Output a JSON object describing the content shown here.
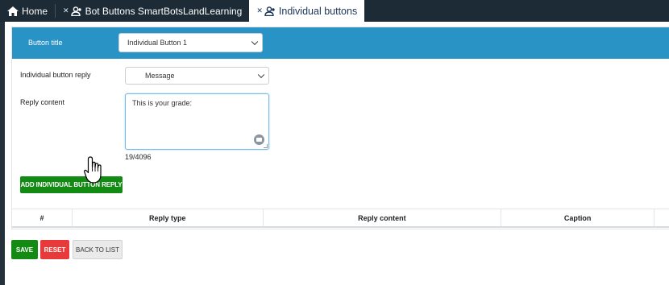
{
  "tabs": [
    {
      "label": "Home",
      "icon": "home-icon"
    },
    {
      "label": "Bot Buttons SmartBotsLandLearning",
      "icon": "user-group-icon"
    },
    {
      "label": "Individual buttons",
      "icon": "user-group-icon"
    }
  ],
  "form": {
    "button_title_label": "Button title",
    "button_title_value": "Individual Button 1",
    "reply_label": "Individual button reply",
    "reply_value": "Message",
    "content_label": "Reply content",
    "content_value": "This is your grade:",
    "counter": "19/4096",
    "add_button_label": "ADD INDIVIDUAL BUTTON REPLY"
  },
  "table": {
    "columns": [
      "#",
      "Reply type",
      "Reply content",
      "Caption"
    ]
  },
  "footer": {
    "save_label": "SAVE",
    "reset_label": "RESET",
    "back_label": "BACK TO LIST"
  },
  "colors": {
    "tabbar": "#1c2b36",
    "blue_band": "#2a93c6",
    "green": "#138a13",
    "red": "#e83a3a"
  }
}
